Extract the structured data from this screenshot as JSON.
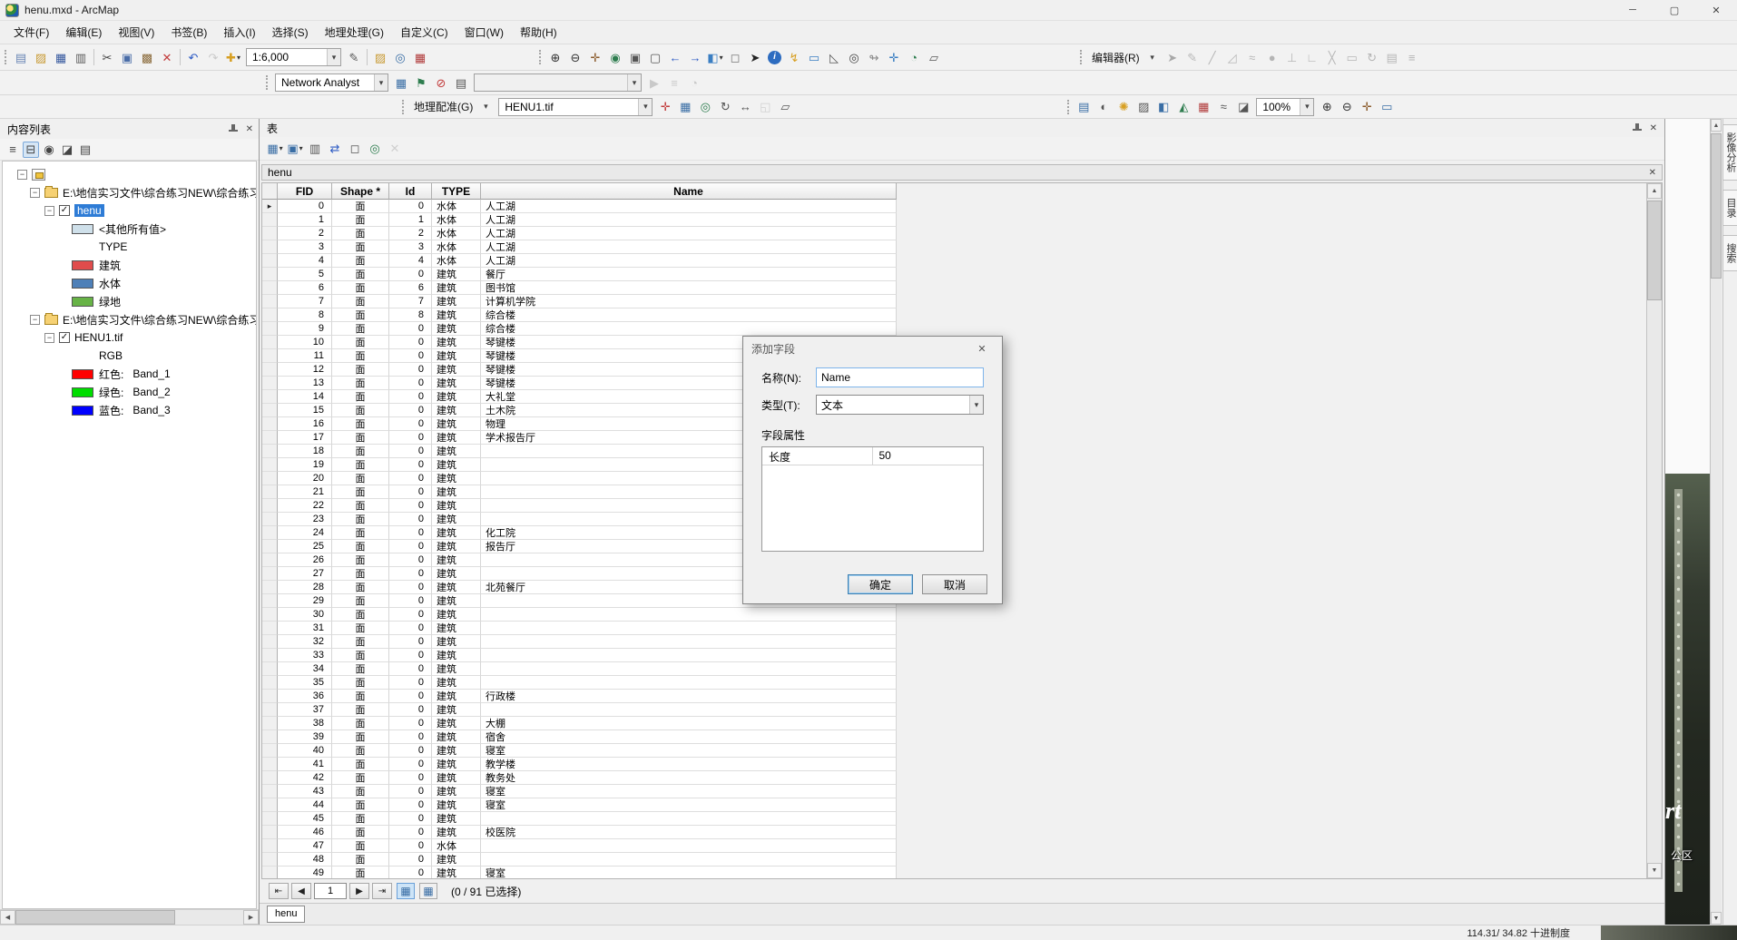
{
  "window": {
    "title": "henu.mxd - ArcMap",
    "controls": {
      "minimize": "─",
      "maximize": "▢",
      "close": "✕"
    }
  },
  "glyphs": {
    "caret": "▾",
    "close": "✕",
    "up": "▲",
    "down": "▼",
    "left": "◀",
    "right": "▶",
    "first": "⇤",
    "last": "⇥",
    "row_pointer": "▸"
  },
  "menubar": {
    "items": [
      "文件(F)",
      "编辑(E)",
      "视图(V)",
      "书签(B)",
      "插入(I)",
      "选择(S)",
      "地理处理(G)",
      "自定义(C)",
      "窗口(W)",
      "帮助(H)"
    ]
  },
  "toolbars": {
    "standard": {
      "file_icons": [
        {
          "n": "new-document-icon",
          "g": "▤",
          "c": "#6b87b5"
        },
        {
          "n": "open-folder-icon",
          "g": "▨",
          "c": "#c89a33"
        },
        {
          "n": "save-icon",
          "g": "▦",
          "c": "#35589e"
        },
        {
          "n": "print-icon",
          "g": "▥",
          "c": "#5a5a5a"
        }
      ],
      "clipboard_icons": [
        {
          "n": "cut-icon",
          "g": "✂",
          "c": "#444444"
        },
        {
          "n": "copy-icon",
          "g": "▣",
          "c": "#4a6da8"
        },
        {
          "n": "paste-icon",
          "g": "▩",
          "c": "#8a6a3a"
        },
        {
          "n": "delete-icon",
          "g": "✕",
          "c": "#c23b3b"
        }
      ],
      "undo_icons": [
        {
          "n": "undo-icon",
          "g": "↶",
          "c": "#2d5bc4"
        },
        {
          "n": "redo-icon",
          "g": "↷",
          "c": "#8a8a8a",
          "d": 1
        }
      ],
      "add_icons": [
        {
          "n": "add-data-icon",
          "g": "✚",
          "c": "#d79f22",
          "v": 1
        }
      ],
      "scale_value": "1:6,000",
      "post_scale_icons": [
        {
          "n": "editor-pencil-icon",
          "g": "✎",
          "c": "#555555"
        }
      ],
      "misc_icons": [
        {
          "n": "catalog-window-icon",
          "g": "▨",
          "c": "#c89a33"
        },
        {
          "n": "search-window-icon",
          "g": "◎",
          "c": "#3a6ea5"
        },
        {
          "n": "arctoolbox-icon",
          "g": "▦",
          "c": "#b03a3a"
        }
      ],
      "nav_icons": [
        {
          "n": "zoom-in-icon",
          "g": "⊕",
          "c": "#333333"
        },
        {
          "n": "zoom-out-icon",
          "g": "⊖",
          "c": "#333333"
        },
        {
          "n": "pan-icon",
          "g": "✛",
          "c": "#8a5a2a"
        },
        {
          "n": "full-extent-icon",
          "g": "◉",
          "c": "#2e7d4f"
        },
        {
          "n": "fixed-zoom-in-icon",
          "g": "▣",
          "c": "#555555"
        },
        {
          "n": "fixed-zoom-out-icon",
          "g": "▢",
          "c": "#555555"
        },
        {
          "n": "back-extent-icon",
          "g": "←",
          "c": "#2d5bc4"
        },
        {
          "n": "forward-extent-icon",
          "g": "→",
          "c": "#2d5bc4"
        },
        {
          "n": "select-features-icon",
          "g": "◧",
          "c": "#3a7ec2",
          "v": 1
        },
        {
          "n": "clear-selection-icon",
          "g": "◻",
          "c": "#777777"
        },
        {
          "n": "select-elements-icon",
          "g": "➤",
          "c": "#222222"
        },
        {
          "n": "identify-icon",
          "g": "i",
          "c": "#ffffff",
          "cls": "round-blue"
        },
        {
          "n": "hyperlink-icon",
          "g": "↯",
          "c": "#d79f22"
        },
        {
          "n": "html-popup-icon",
          "g": "▭",
          "c": "#3a7ec2"
        },
        {
          "n": "measure-icon",
          "g": "◺",
          "c": "#555555"
        },
        {
          "n": "find-icon",
          "g": "◎",
          "c": "#444444"
        },
        {
          "n": "find-route-icon",
          "g": "↬",
          "c": "#8a8a8a"
        },
        {
          "n": "go-to-xy-icon",
          "g": "✛",
          "c": "#3a7ec2"
        },
        {
          "n": "time-slider-icon",
          "g": "◔",
          "c": "#2e7d4f"
        },
        {
          "n": "viewer-window-icon",
          "g": "▱",
          "c": "#555555"
        }
      ]
    },
    "editor": {
      "label": "编辑器(R)",
      "icons": [
        {
          "n": "edit-tool-icon",
          "g": "➤",
          "c": "#333333",
          "d": 1
        },
        {
          "n": "edit-annotation-icon",
          "g": "✎",
          "c": "#555555",
          "d": 1
        },
        {
          "n": "straight-segment-icon",
          "g": "╱",
          "c": "#555555",
          "d": 1
        },
        {
          "n": "endpoint-arc-icon",
          "g": "◿",
          "c": "#555555",
          "d": 1
        },
        {
          "n": "trace-icon",
          "g": "≈",
          "c": "#555555",
          "d": 1
        },
        {
          "n": "point-tool-icon",
          "g": "●",
          "c": "#555555",
          "d": 1
        },
        {
          "n": "edit-vertices-icon",
          "g": "⊥",
          "c": "#555555",
          "d": 1
        },
        {
          "n": "reshape-feature-icon",
          "g": "∟",
          "c": "#555555",
          "d": 1
        },
        {
          "n": "cut-polygons-icon",
          "g": "╳",
          "c": "#555555",
          "d": 1
        },
        {
          "n": "split-tool-icon",
          "g": "▭",
          "c": "#555555",
          "d": 1
        },
        {
          "n": "rotate-tool-icon",
          "g": "↻",
          "c": "#555555",
          "d": 1
        },
        {
          "n": "attributes-window-icon",
          "g": "▤",
          "c": "#555555",
          "d": 1
        },
        {
          "n": "sketch-properties-icon",
          "g": "≡",
          "c": "#555555",
          "d": 1
        }
      ]
    },
    "network": {
      "label": "Network Analyst",
      "window_icons": [
        {
          "n": "network-analyst-window-icon",
          "g": "▦",
          "c": "#3a6ea5"
        },
        {
          "n": "create-network-location-icon",
          "g": "⚑",
          "c": "#2e7d4f"
        },
        {
          "n": "barrier-icon",
          "g": "⊘",
          "c": "#c23b3b"
        },
        {
          "n": "network-attributes-icon",
          "g": "▤",
          "c": "#555555"
        }
      ],
      "route_value": "",
      "solve_icons": [
        {
          "n": "solve-icon",
          "g": "▶",
          "c": "#888888",
          "d": 1
        },
        {
          "n": "directions-icon",
          "g": "≡",
          "c": "#888888",
          "d": 1
        },
        {
          "n": "time-window-icon",
          "g": "◔",
          "c": "#888888",
          "d": 1
        }
      ]
    },
    "georef": {
      "label": "地理配准(G)",
      "layer_value": "HENU1.tif",
      "icons": [
        {
          "n": "add-control-points-icon",
          "g": "✛",
          "c": "#c23b3b"
        },
        {
          "n": "link-table-icon",
          "g": "▦",
          "c": "#3a6ea5"
        },
        {
          "n": "zoom-to-layer-icon",
          "g": "◎",
          "c": "#2e7d4f"
        },
        {
          "n": "rotate-icon",
          "g": "↻",
          "c": "#555555"
        },
        {
          "n": "shift-icon",
          "g": "↔",
          "c": "#555555"
        },
        {
          "n": "auto-registration-icon",
          "g": "◱",
          "c": "#999999",
          "d": 1
        },
        {
          "n": "update-georeferencing-icon",
          "g": "▱",
          "c": "#555555"
        }
      ]
    },
    "effects": {
      "icons_a": [
        {
          "n": "image-analysis-icon",
          "g": "▤",
          "c": "#3a6ea5"
        },
        {
          "n": "contrast-icon",
          "g": "◐",
          "c": "#555555"
        },
        {
          "n": "brightness-icon",
          "g": "✺",
          "c": "#d79f22"
        },
        {
          "n": "transparency-icon",
          "g": "▨",
          "c": "#555555"
        },
        {
          "n": "swipe-layer-icon",
          "g": "◧",
          "c": "#3a6ea5"
        },
        {
          "n": "flicker-layer-icon",
          "g": "◭",
          "c": "#2e7d4f"
        },
        {
          "n": "band-combination-icon",
          "g": "▦",
          "c": "#b03a3a"
        },
        {
          "n": "stretch-icon",
          "g": "≈",
          "c": "#555555"
        },
        {
          "n": "dra-icon",
          "g": "◪",
          "c": "#555555"
        }
      ],
      "zoom_value": "100%",
      "icons_b": [
        {
          "n": "raster-zoom-in-icon",
          "g": "⊕",
          "c": "#333333"
        },
        {
          "n": "raster-zoom-out-icon",
          "g": "⊖",
          "c": "#333333"
        },
        {
          "n": "raster-pan-icon",
          "g": "✛",
          "c": "#8a5a2a"
        },
        {
          "n": "raster-identify-icon",
          "g": "▭",
          "c": "#3a6ea5"
        }
      ]
    }
  },
  "toc": {
    "title": "内容列表",
    "tools": [
      {
        "n": "list-by-drawing-order-icon",
        "g": "≡",
        "c": "#444444"
      },
      {
        "n": "list-by-source-icon",
        "g": "⊟",
        "c": "#444444",
        "cls": "pressed"
      },
      {
        "n": "list-by-visibility-icon",
        "g": "◉",
        "c": "#444444"
      },
      {
        "n": "list-by-selection-icon",
        "g": "◪",
        "c": "#444444"
      },
      {
        "n": "toc-options-icon",
        "g": "▤",
        "c": "#444444"
      }
    ],
    "source1": "E:\\地信实习文件\\综合练习NEW\\综合练习",
    "layer1": {
      "name": "henu",
      "other_values": "<其他所有值>",
      "other_color": "#cfe0ea",
      "legend_field": "TYPE",
      "classes": [
        {
          "label": "建筑",
          "color": "#e04c4c"
        },
        {
          "label": "水体",
          "color": "#4e80b8"
        },
        {
          "label": "绿地",
          "color": "#67b346"
        }
      ]
    },
    "source2": "E:\\地信实习文件\\综合练习NEW\\综合练习",
    "layer2": {
      "name": "HENU1.tif",
      "composite": "RGB",
      "bands": [
        {
          "label": "红色:",
          "band": "Band_1",
          "color": "#ff0000"
        },
        {
          "label": "绿色:",
          "band": "Band_2",
          "color": "#00dd00"
        },
        {
          "label": "蓝色:",
          "band": "Band_3",
          "color": "#0000ff"
        }
      ]
    }
  },
  "table_panel": {
    "title": "表",
    "tools": [
      {
        "n": "table-options-icon",
        "g": "▦",
        "c": "#3a6ea5",
        "v": 1
      },
      {
        "n": "related-tables-icon",
        "g": "▣",
        "c": "#3a6ea5",
        "v": 1
      },
      {
        "n": "select-by-attributes-icon",
        "g": "▥",
        "c": "#555555"
      },
      {
        "n": "switch-selection-icon",
        "g": "⇄",
        "c": "#2d5bc4"
      },
      {
        "n": "clear-table-selection-icon",
        "g": "◻",
        "c": "#555555"
      },
      {
        "n": "zoom-to-selected-icon",
        "g": "◎",
        "c": "#2e7d4f"
      },
      {
        "n": "delete-selected-icon",
        "g": "✕",
        "c": "#999999",
        "d": 1
      }
    ],
    "doc_title": "henu",
    "columns": [
      "FID",
      "Shape *",
      "Id",
      "TYPE",
      "Name"
    ],
    "rows": [
      [
        0,
        "面",
        0,
        "水体",
        "人工湖"
      ],
      [
        1,
        "面",
        1,
        "水体",
        "人工湖"
      ],
      [
        2,
        "面",
        2,
        "水体",
        "人工湖"
      ],
      [
        3,
        "面",
        3,
        "水体",
        "人工湖"
      ],
      [
        4,
        "面",
        4,
        "水体",
        "人工湖"
      ],
      [
        5,
        "面",
        0,
        "建筑",
        "餐厅"
      ],
      [
        6,
        "面",
        6,
        "建筑",
        "图书馆"
      ],
      [
        7,
        "面",
        7,
        "建筑",
        "计算机学院"
      ],
      [
        8,
        "面",
        8,
        "建筑",
        "综合楼"
      ],
      [
        9,
        "面",
        0,
        "建筑",
        "综合楼"
      ],
      [
        10,
        "面",
        0,
        "建筑",
        "琴键楼"
      ],
      [
        11,
        "面",
        0,
        "建筑",
        "琴键楼"
      ],
      [
        12,
        "面",
        0,
        "建筑",
        "琴键楼"
      ],
      [
        13,
        "面",
        0,
        "建筑",
        "琴键楼"
      ],
      [
        14,
        "面",
        0,
        "建筑",
        "大礼堂"
      ],
      [
        15,
        "面",
        0,
        "建筑",
        "土木院"
      ],
      [
        16,
        "面",
        0,
        "建筑",
        "物理"
      ],
      [
        17,
        "面",
        0,
        "建筑",
        "学术报告厅"
      ],
      [
        18,
        "面",
        0,
        "建筑",
        ""
      ],
      [
        19,
        "面",
        0,
        "建筑",
        ""
      ],
      [
        20,
        "面",
        0,
        "建筑",
        ""
      ],
      [
        21,
        "面",
        0,
        "建筑",
        ""
      ],
      [
        22,
        "面",
        0,
        "建筑",
        ""
      ],
      [
        23,
        "面",
        0,
        "建筑",
        ""
      ],
      [
        24,
        "面",
        0,
        "建筑",
        "化工院"
      ],
      [
        25,
        "面",
        0,
        "建筑",
        "报告厅"
      ],
      [
        26,
        "面",
        0,
        "建筑",
        ""
      ],
      [
        27,
        "面",
        0,
        "建筑",
        ""
      ],
      [
        28,
        "面",
        0,
        "建筑",
        "北苑餐厅"
      ],
      [
        29,
        "面",
        0,
        "建筑",
        ""
      ],
      [
        30,
        "面",
        0,
        "建筑",
        ""
      ],
      [
        31,
        "面",
        0,
        "建筑",
        ""
      ],
      [
        32,
        "面",
        0,
        "建筑",
        ""
      ],
      [
        33,
        "面",
        0,
        "建筑",
        ""
      ],
      [
        34,
        "面",
        0,
        "建筑",
        ""
      ],
      [
        35,
        "面",
        0,
        "建筑",
        ""
      ],
      [
        36,
        "面",
        0,
        "建筑",
        "行政楼"
      ],
      [
        37,
        "面",
        0,
        "建筑",
        ""
      ],
      [
        38,
        "面",
        0,
        "建筑",
        "大棚"
      ],
      [
        39,
        "面",
        0,
        "建筑",
        "宿舍"
      ],
      [
        40,
        "面",
        0,
        "建筑",
        "寝室"
      ],
      [
        41,
        "面",
        0,
        "建筑",
        "教学楼"
      ],
      [
        42,
        "面",
        0,
        "建筑",
        "教务处"
      ],
      [
        43,
        "面",
        0,
        "建筑",
        "寝室"
      ],
      [
        44,
        "面",
        0,
        "建筑",
        "寝室"
      ],
      [
        45,
        "面",
        0,
        "建筑",
        ""
      ],
      [
        46,
        "面",
        0,
        "建筑",
        "校医院"
      ],
      [
        47,
        "面",
        0,
        "水体",
        ""
      ],
      [
        48,
        "面",
        0,
        "建筑",
        ""
      ],
      [
        49,
        "面",
        0,
        "建筑",
        "寝室"
      ]
    ],
    "nav": {
      "page": "1",
      "info": "(0 / 91 已选择)"
    },
    "tab": "henu"
  },
  "dialog": {
    "title": "添加字段",
    "name_label": "名称(N):",
    "name_value": "Name",
    "type_label": "类型(T):",
    "type_value": "文本",
    "group_label": "字段属性",
    "properties": [
      {
        "key": "长度",
        "value": "50"
      }
    ],
    "ok_label": "确定",
    "cancel_label": "取消"
  },
  "map_strip": {
    "label_big": "rt",
    "label_small": "公区"
  },
  "right_dock": {
    "tabs": [
      "影像分析",
      "目录",
      "搜索"
    ]
  },
  "statusbar": {
    "coords": "114.31/ 34.82 十进制度"
  }
}
